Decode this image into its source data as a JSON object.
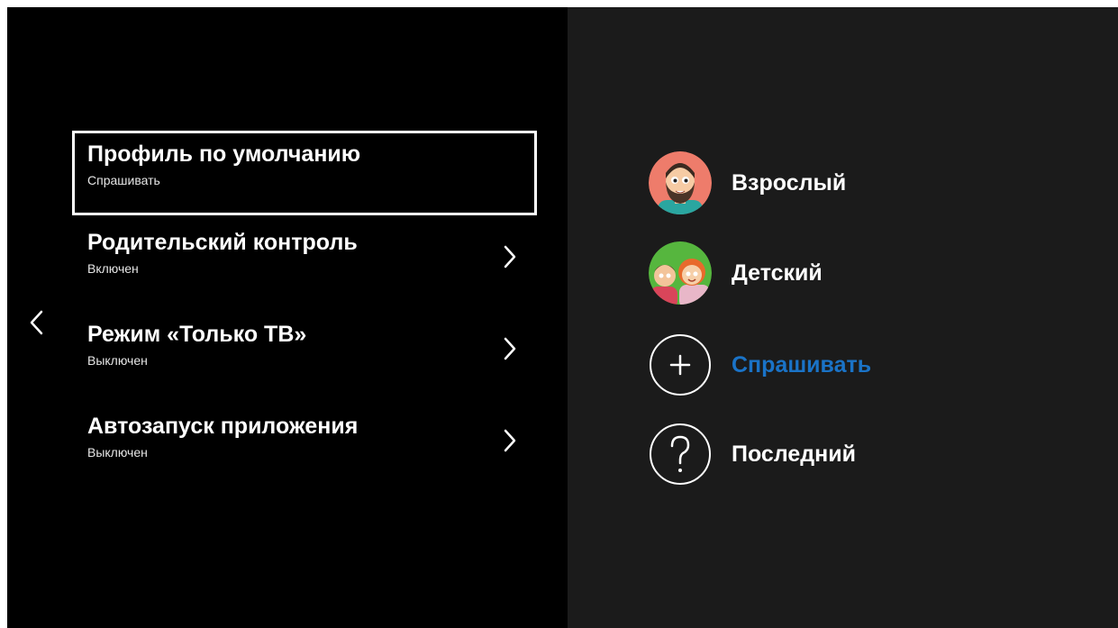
{
  "settings_menu": {
    "items": [
      {
        "title": "Профиль по умолчанию",
        "value": "Спрашивать",
        "focused": true,
        "has_chevron": false
      },
      {
        "title": "Родительский контроль",
        "value": "Включен",
        "focused": false,
        "has_chevron": true
      },
      {
        "title": "Режим «Только ТВ»",
        "value": "Выключен",
        "focused": false,
        "has_chevron": true
      },
      {
        "title": "Автозапуск приложения",
        "value": "Выключен",
        "focused": false,
        "has_chevron": true
      }
    ]
  },
  "profile_options": {
    "items": [
      {
        "label": "Взрослый",
        "icon": "adult-avatar-icon",
        "selected": false
      },
      {
        "label": "Детский",
        "icon": "kids-avatar-icon",
        "selected": false
      },
      {
        "label": "Спрашивать",
        "icon": "plus-circle-icon",
        "selected": true
      },
      {
        "label": "Последний",
        "icon": "question-circle-icon",
        "selected": false
      }
    ]
  },
  "colors": {
    "screen_bg": "#000000",
    "panel_bg": "#1b1b1b",
    "text": "#ffffff",
    "accent": "#1a73c7"
  }
}
